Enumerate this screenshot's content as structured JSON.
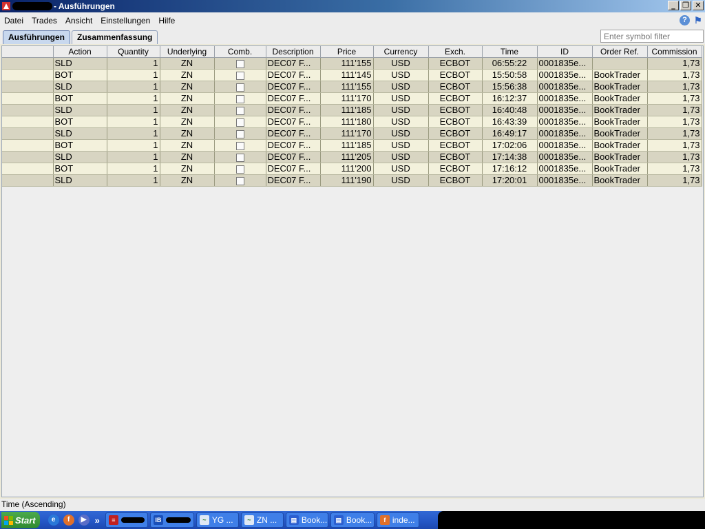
{
  "window": {
    "title": "- Ausführungen",
    "controls": [
      "minimize-icon",
      "restore-icon",
      "close-icon"
    ]
  },
  "menu": [
    "Datei",
    "Trades",
    "Ansicht",
    "Einstellungen",
    "Hilfe"
  ],
  "tabs": [
    {
      "label": "Ausführungen",
      "active": true
    },
    {
      "label": "Zusammenfassung",
      "active": false
    }
  ],
  "symbol_filter": {
    "placeholder": "Enter symbol filter",
    "value": ""
  },
  "table": {
    "columns": [
      "",
      "Action",
      "Quantity",
      "Underlying",
      "Comb.",
      "Description",
      "Price",
      "Currency",
      "Exch.",
      "Time",
      "ID",
      "Order Ref.",
      "Commission"
    ],
    "rows": [
      {
        "action": "SLD",
        "qty": "1",
        "und": "ZN",
        "comb": false,
        "desc": "DEC07 F...",
        "price": "111'155",
        "cur": "USD",
        "exch": "ECBOT",
        "time": "06:55:22",
        "id": "0001835e...",
        "ref": "",
        "comm": "1,73"
      },
      {
        "action": "BOT",
        "qty": "1",
        "und": "ZN",
        "comb": false,
        "desc": "DEC07 F...",
        "price": "111'145",
        "cur": "USD",
        "exch": "ECBOT",
        "time": "15:50:58",
        "id": "0001835e...",
        "ref": "BookTrader",
        "comm": "1,73"
      },
      {
        "action": "SLD",
        "qty": "1",
        "und": "ZN",
        "comb": false,
        "desc": "DEC07 F...",
        "price": "111'155",
        "cur": "USD",
        "exch": "ECBOT",
        "time": "15:56:38",
        "id": "0001835e...",
        "ref": "BookTrader",
        "comm": "1,73"
      },
      {
        "action": "BOT",
        "qty": "1",
        "und": "ZN",
        "comb": false,
        "desc": "DEC07 F...",
        "price": "111'170",
        "cur": "USD",
        "exch": "ECBOT",
        "time": "16:12:37",
        "id": "0001835e...",
        "ref": "BookTrader",
        "comm": "1,73"
      },
      {
        "action": "SLD",
        "qty": "1",
        "und": "ZN",
        "comb": false,
        "desc": "DEC07 F...",
        "price": "111'185",
        "cur": "USD",
        "exch": "ECBOT",
        "time": "16:40:48",
        "id": "0001835e...",
        "ref": "BookTrader",
        "comm": "1,73"
      },
      {
        "action": "BOT",
        "qty": "1",
        "und": "ZN",
        "comb": false,
        "desc": "DEC07 F...",
        "price": "111'180",
        "cur": "USD",
        "exch": "ECBOT",
        "time": "16:43:39",
        "id": "0001835e...",
        "ref": "BookTrader",
        "comm": "1,73"
      },
      {
        "action": "SLD",
        "qty": "1",
        "und": "ZN",
        "comb": false,
        "desc": "DEC07 F...",
        "price": "111'170",
        "cur": "USD",
        "exch": "ECBOT",
        "time": "16:49:17",
        "id": "0001835e...",
        "ref": "BookTrader",
        "comm": "1,73"
      },
      {
        "action": "BOT",
        "qty": "1",
        "und": "ZN",
        "comb": false,
        "desc": "DEC07 F...",
        "price": "111'185",
        "cur": "USD",
        "exch": "ECBOT",
        "time": "17:02:06",
        "id": "0001835e...",
        "ref": "BookTrader",
        "comm": "1,73"
      },
      {
        "action": "SLD",
        "qty": "1",
        "und": "ZN",
        "comb": false,
        "desc": "DEC07 F...",
        "price": "111'205",
        "cur": "USD",
        "exch": "ECBOT",
        "time": "17:14:38",
        "id": "0001835e...",
        "ref": "BookTrader",
        "comm": "1,73"
      },
      {
        "action": "BOT",
        "qty": "1",
        "und": "ZN",
        "comb": false,
        "desc": "DEC07 F...",
        "price": "111'200",
        "cur": "USD",
        "exch": "ECBOT",
        "time": "17:16:12",
        "id": "0001835e...",
        "ref": "BookTrader",
        "comm": "1,73"
      },
      {
        "action": "SLD",
        "qty": "1",
        "und": "ZN",
        "comb": false,
        "desc": "DEC07 F...",
        "price": "111'190",
        "cur": "USD",
        "exch": "ECBOT",
        "time": "17:20:01",
        "id": "0001835e...",
        "ref": "BookTrader",
        "comm": "1,73"
      }
    ]
  },
  "status": "Time (Ascending)",
  "taskbar": {
    "start_label": "Start",
    "quicklaunch": [
      "ie-icon",
      "firefox-icon",
      "media-player-icon"
    ],
    "tasks": [
      {
        "icon": "app-icon",
        "label": ""
      },
      {
        "icon": "ib-icon",
        "label": ""
      },
      {
        "icon": "chart-icon",
        "label": "YG    ..."
      },
      {
        "icon": "chart-icon",
        "label": "ZN    ..."
      },
      {
        "icon": "book-icon",
        "label": "Book..."
      },
      {
        "icon": "book-icon",
        "label": "Book..."
      },
      {
        "icon": "firefox-icon",
        "label": "inde..."
      }
    ]
  },
  "colors": {
    "row_even": "#d8d5c2",
    "row_odd": "#f3f1dc",
    "titlebar": "#0a246a",
    "taskbar": "#2456c5"
  }
}
